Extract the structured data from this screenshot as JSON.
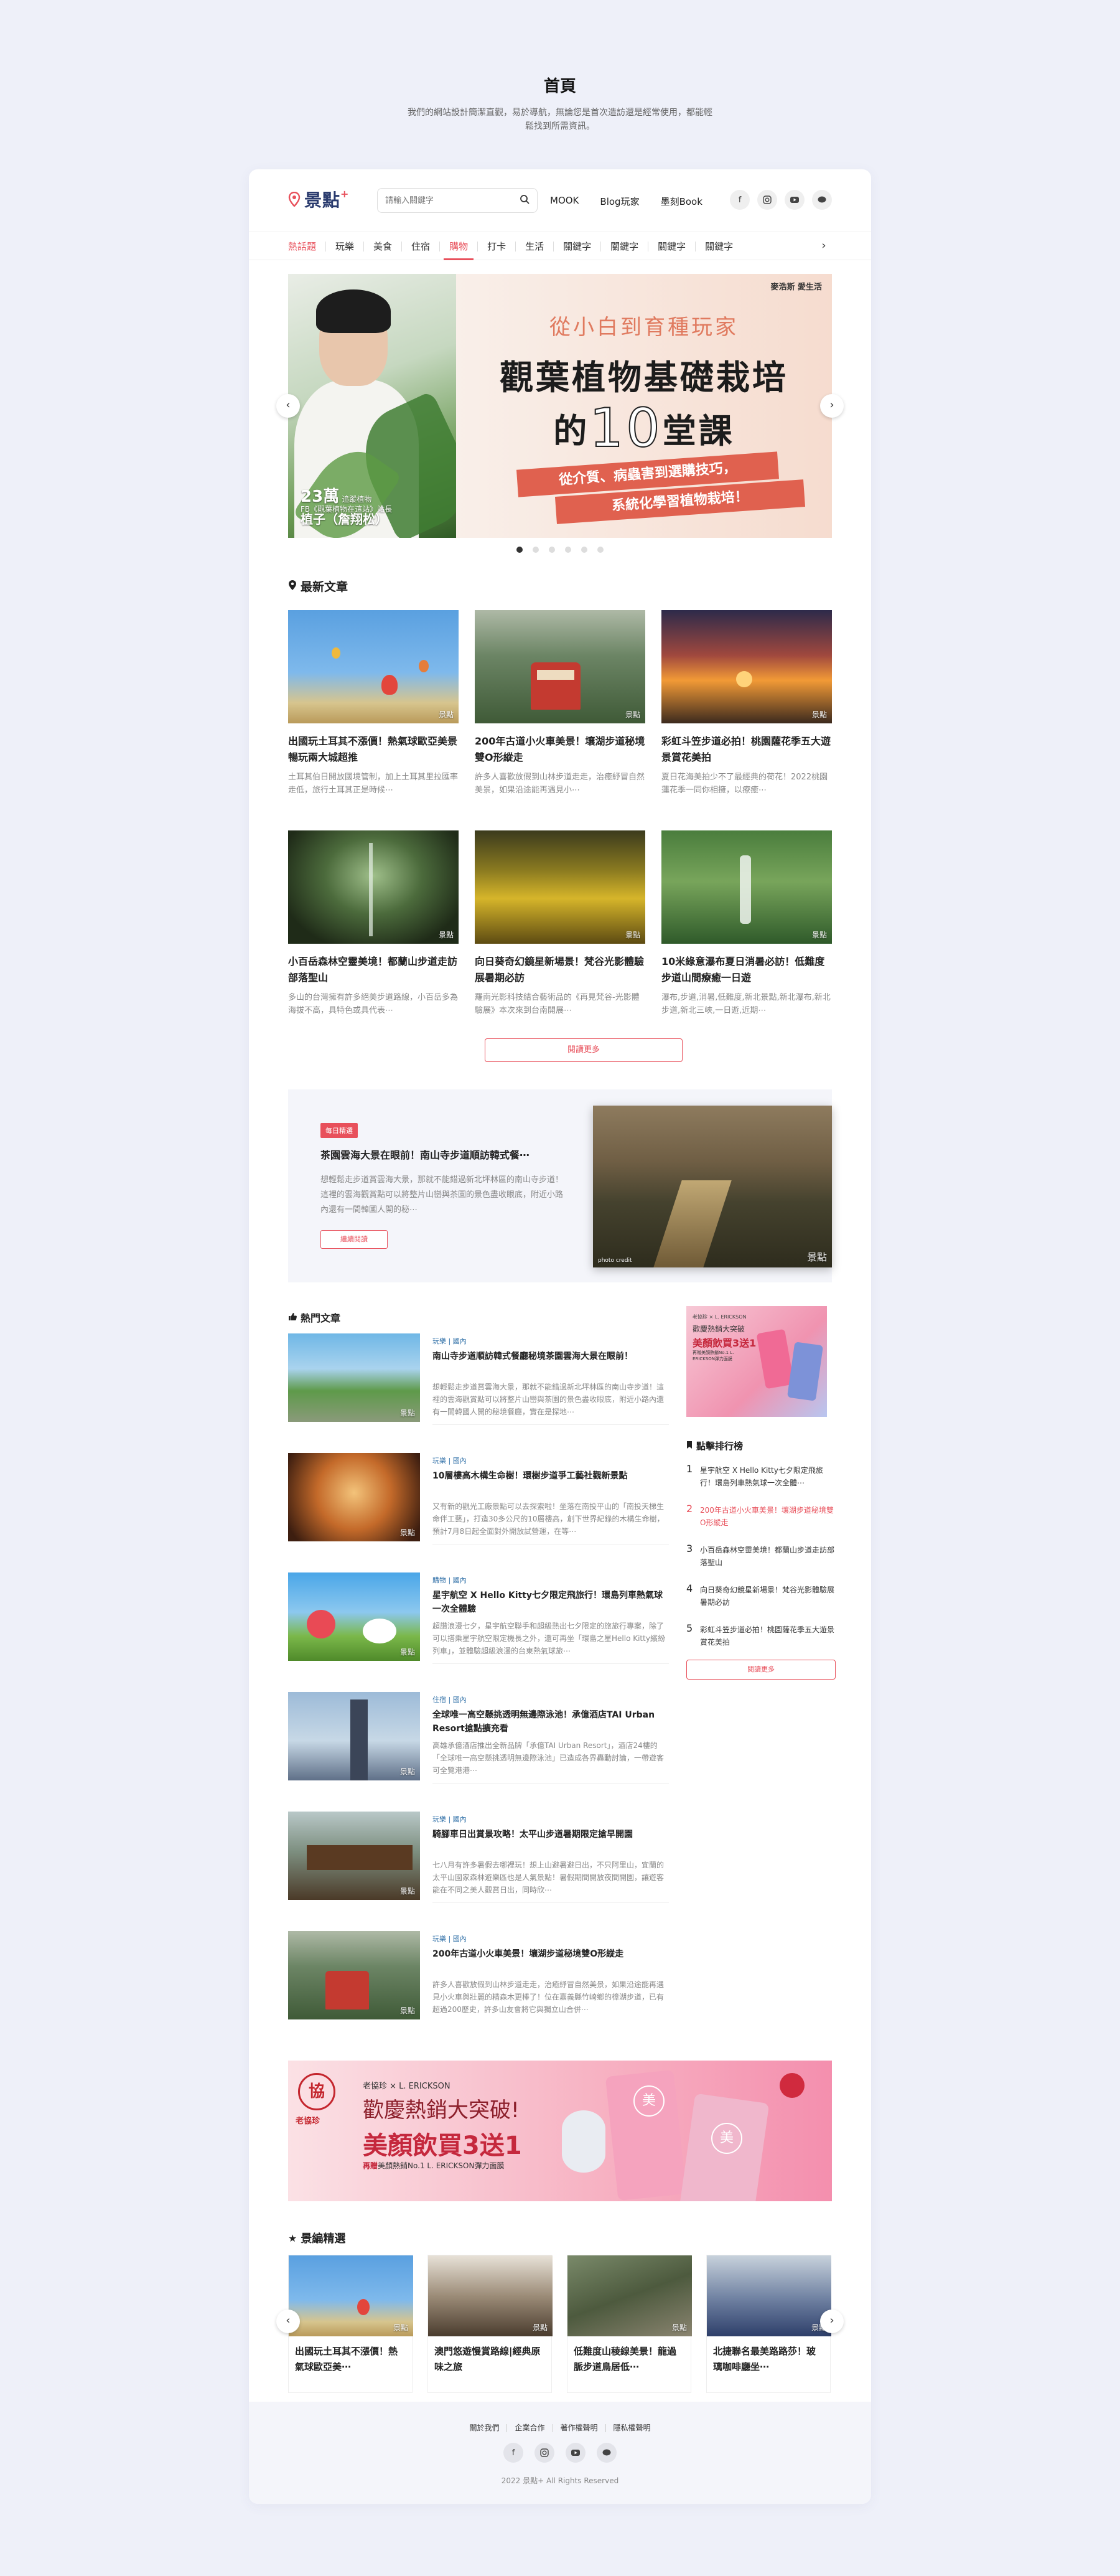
{
  "page": {
    "title": "首頁",
    "description": "我們的網站設計簡潔直觀，易於導航，無論您是首次造訪還是經常使用，都能輕鬆找到所需資訊。"
  },
  "header": {
    "logo_text": "景點",
    "logo_plus": "+",
    "search_placeholder": "請輸入關鍵字",
    "nav": [
      "MOOK",
      "Blog玩家",
      "墨刻Book"
    ],
    "social_icons": [
      "facebook-icon",
      "instagram-icon",
      "youtube-icon",
      "line-icon"
    ]
  },
  "categories": [
    "熱話題",
    "玩樂",
    "美食",
    "住宿",
    "購物",
    "打卡",
    "生活",
    "關鍵字",
    "關鍵字",
    "關鍵字",
    "關鍵字"
  ],
  "active_category": "購物",
  "hero": {
    "brand": "麥浩斯 愛生活",
    "subtitle": "從小白到育種玩家",
    "title_line1": "觀葉植物基礎栽培",
    "title_pre": "的",
    "title_num": "10",
    "title_post": "堂課",
    "ribbon1": "從介質、病蟲害到選購技巧，",
    "ribbon2": "系統化學習植物栽培！",
    "caption_num": "23萬",
    "caption_small": "追蹤植物",
    "caption_line2": "FB《觀葉植物在這站》站長",
    "caption_name": "植子（詹翔松）",
    "dots": 6,
    "active_dot": 0
  },
  "latest": {
    "title": "最新文章",
    "watermark": "景點",
    "items": [
      {
        "title": "出國玩土耳其不漲價！熱氣球歐亞美景暢玩兩大城超推",
        "desc": "土耳其伯日開放國境管制，加上土耳其里拉匯率走低，旅行土耳其正是時候⋯"
      },
      {
        "title": "200年古道小火車美景！壤湖步道秘境雙O形縱走",
        "desc": "許多人喜歡放假到山林步道走走，治癒紓冒自然美景，如果沿途能再遇見小⋯"
      },
      {
        "title": "彩虹斗笠步道必拍！桃園薩花季五大遊景賞花美拍",
        "desc": "夏日花海美拍少不了最經典的荷花！2022桃園蓮花季一同你相擁，以療癒⋯"
      },
      {
        "title": "小百岳森林空靈美境！都蘭山步道走訪部落聖山",
        "desc": "多山的台灣擁有許多絕美步道路線，小百岳多為海拔不高，具特色或具代表⋯"
      },
      {
        "title": "向日葵奇幻鏡星新場景！梵谷光影體驗展暑期必訪",
        "desc": "羅南光影科技結合藝術品的《再見梵谷-光影體驗展》本次來到台南開展⋯"
      },
      {
        "title": "10米綠意瀑布夏日消暑必訪！低難度步道山間療癒一日遊",
        "desc": "瀑布,步道,消暑,低難度,新北景點,新北瀑布,新北步道,新北三峽,一日遊,近期⋯"
      }
    ],
    "more_label": "閱讀更多"
  },
  "feature": {
    "tag": "每日精選",
    "title": "茶園雲海大景在眼前！南山寺步道順訪韓式餐⋯",
    "desc": "想輕鬆走步道賞雲海大景，那就不能錯過新北坪林區的南山寺步道！這裡的雲海觀賞點可以將整片山巒與茶園的景色盡收眼底，附近小路內還有一間韓國人開的秘⋯",
    "button": "繼續閱讀",
    "credit": "photo credit"
  },
  "hot": {
    "title": "熱門文章",
    "items": [
      {
        "meta": "玩樂 | 國內",
        "title": "南山寺步道順訪韓式餐廳秘境茶園雲海大景在眼前！",
        "desc": "想輕鬆走步道賞雲海大景，那就不能錯過新北坪林區的南山寺步道！這裡的雲海觀賞點可以將整片山巒與茶園的景色盡收眼底，附近小路內還有一間韓國人開的秘境餐廳，實在是探地⋯"
      },
      {
        "meta": "玩樂 | 國內",
        "title": "10層樓高木構生命樹！環樹步道爭工藝社觀新景點",
        "desc": "又有新的觀光工廠景點可以去探索啦！坐落在南投平山的「南投天梯生命伴工藝」，打造30多公尺的10層樓高，創下世界紀錄的木構生命樹，預計7月8日起全面對外開放試營運，在等⋯"
      },
      {
        "meta": "購物 | 國內",
        "title": "星宇航空 X Hello Kitty七夕限定飛旅行！環島列車熱氣球一次全體驗",
        "desc": "超讚浪漫七夕，星宇航空聯手和超級熱出七夕限定的旅旅行專案，除了可以搭乘星宇航空限定機長之外，還可再坐「環島之星Hello Kitty繽紛列車」，並體驗超級浪漫的台東熱氣球旅⋯"
      },
      {
        "meta": "住宿 | 國內",
        "title": "全球唯一高空懸挑透明無邊際泳池！承億酒店TAI Urban Resort搶點擴充看",
        "desc": "高雄承億酒店推出全新品牌「承億TAI Urban Resort」，酒店24樓的「全球唯一高空懸挑透明無邊際泳池」已造成各界轟動討論，一帶遊客可全覽港港⋯"
      },
      {
        "meta": "玩樂 | 國內",
        "title": "騎腳車日出賞景攻略！太平山步道暑期限定搶早開園",
        "desc": "七八月有許多暑假去哪裡玩！想上山避暑避日出，不只阿里山，宜蘭的太平山國家森林遊樂區也是人氣景點！暑假期間開放夜間開園，讓遊客能在不同之美人觀賞日出，同時欣⋯"
      },
      {
        "meta": "玩樂 | 國內",
        "title": "200年古道小火車美景！壤湖步道秘境雙O形縱走",
        "desc": "許多人喜歡放假到山林步道走走，治癒紓冒自然美景，如果沿途能再遇見小火車與壯麗的精森木更棒了！位在嘉義縣竹崎鄉的樟湖步道，已有超過200歷史，許多山友會將它與獨立山合併⋯"
      }
    ]
  },
  "sidebar_ad": {
    "brand": "老協珍 × L. ERICKSON",
    "line1": "歡慶熱銷大突破",
    "line2": "美顏飲買3送1",
    "line3": "再贈美顏熱銷No.1 L. ERICKSON彈力面膜"
  },
  "ranking": {
    "title": "點擊排行榜",
    "items": [
      {
        "n": "1",
        "title": "星宇航空 X Hello Kitty七夕限定飛旅行！環島列車熱氣球一次全體⋯"
      },
      {
        "n": "2",
        "title": "200年古道小火車美景！壤湖步道秘境雙O形縱走"
      },
      {
        "n": "3",
        "title": "小百岳森林空靈美境！都蘭山步道走訪部落聖山"
      },
      {
        "n": "4",
        "title": "向日葵奇幻鏡星新場景！梵谷光影體驗展暑期必訪"
      },
      {
        "n": "5",
        "title": "彩虹斗笠步道必拍！桃園薩花季五大遊景賞花美拍"
      }
    ],
    "more_label": "閱讀更多"
  },
  "banner_ad": {
    "logo": "老協珍",
    "brand": "老協珍 × L. ERICKSON",
    "line1": "歡慶熱銷大突破!",
    "line2": "美顏飲買3送1",
    "line3_prefix": "再贈",
    "line3": "美顏熱銷No.1 L. ERICKSON彈力面膜",
    "badge": "美"
  },
  "picks": {
    "title": "景編精選",
    "items": [
      {
        "title": "出國玩土耳其不漲價！熱氣球歐亞美⋯"
      },
      {
        "title": "澳門悠遊慢賞路線|經典原味之旅"
      },
      {
        "title": "低難度山稜線美景！龍過脈步道鳥居低⋯"
      },
      {
        "title": "北捷聯名最美路路莎！玻璃咖啡廳坐⋯"
      }
    ]
  },
  "footer": {
    "links": [
      "關於我們",
      "企業合作",
      "著作權聲明",
      "隱私權聲明"
    ],
    "copyright": "2022 景點+ All Rights Reserved"
  },
  "colors": {
    "accent": "#e8505b",
    "navy": "#2a3b6e",
    "background": "#eef0f9"
  }
}
